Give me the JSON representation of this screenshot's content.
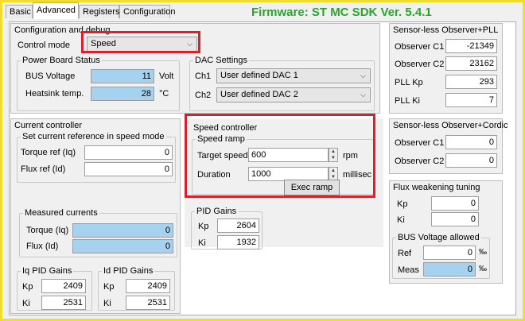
{
  "colors": {
    "accent_frame": "#f0dc2c",
    "firmware_green": "#2aa42e",
    "highlight_red": "#d8212c",
    "readonly_blue": "#a7d2ef"
  },
  "tabs": [
    {
      "label": "Basic"
    },
    {
      "label": "Advanced",
      "active": true
    },
    {
      "label": "Registers"
    },
    {
      "label": "Configuration"
    }
  ],
  "firmware": "Firmware: ST MC SDK Ver. 5.4.1",
  "config": {
    "title": "Configuration and debug",
    "control_mode_label": "Control mode",
    "control_mode_value": "Speed"
  },
  "power_board": {
    "title": "Power Board Status",
    "bus_voltage_label": "BUS Voltage",
    "bus_voltage_value": "11",
    "bus_voltage_unit": "Volt",
    "heatsink_label": "Heatsink temp.",
    "heatsink_value": "28",
    "heatsink_unit": "°C"
  },
  "dac": {
    "title": "DAC Settings",
    "ch1_label": "Ch1",
    "ch1_value": "User defined DAC 1",
    "ch2_label": "Ch2",
    "ch2_value": "User defined DAC 2"
  },
  "observer_pll": {
    "title": "Sensor-less Observer+PLL",
    "c1_label": "Observer C1",
    "c1_value": "-21349",
    "c2_label": "Observer C2",
    "c2_value": "23162",
    "kp_label": "PLL Kp",
    "kp_value": "293",
    "ki_label": "PLL Ki",
    "ki_value": "7"
  },
  "current_controller": {
    "title": "Current controller",
    "ref_group_title": "Set current reference in speed mode",
    "torque_ref_label": "Torque ref (Iq)",
    "torque_ref_value": "0",
    "flux_ref_label": "Flux ref (Id)",
    "flux_ref_value": "0",
    "measured_title": "Measured currents",
    "torque_meas_label": "Torque (Iq)",
    "torque_meas_value": "0",
    "flux_meas_label": "Flux (Id)",
    "flux_meas_value": "0",
    "iq_gains_title": "Iq PID Gains",
    "iq_kp_label": "Kp",
    "iq_kp_value": "2409",
    "iq_ki_label": "Ki",
    "iq_ki_value": "2531",
    "id_gains_title": "Id PID Gains",
    "id_kp_label": "Kp",
    "id_kp_value": "2409",
    "id_ki_label": "Ki",
    "id_ki_value": "2531"
  },
  "speed_controller": {
    "title": "Speed controller",
    "ramp_title": "Speed ramp",
    "target_label": "Target speed",
    "target_value": "600",
    "target_unit": "rpm",
    "duration_label": "Duration",
    "duration_value": "1000",
    "duration_unit": "millisec",
    "exec_label": "Exec ramp",
    "pid_title": "PID Gains",
    "kp_label": "Kp",
    "kp_value": "2604",
    "ki_label": "Ki",
    "ki_value": "1932"
  },
  "observer_cordic": {
    "title": "Sensor-less Observer+Cordic",
    "c1_label": "Observer C1",
    "c1_value": "0",
    "c2_label": "Observer C2",
    "c2_value": "0"
  },
  "flux_weakening": {
    "title": "Flux weakening tuning",
    "kp_label": "Kp",
    "kp_value": "0",
    "ki_label": "Ki",
    "ki_value": "0",
    "bus_title": "BUS Voltage allowed",
    "ref_label": "Ref",
    "ref_value": "0",
    "ref_unit": "‰",
    "meas_label": "Meas",
    "meas_value": "0",
    "meas_unit": "‰"
  }
}
